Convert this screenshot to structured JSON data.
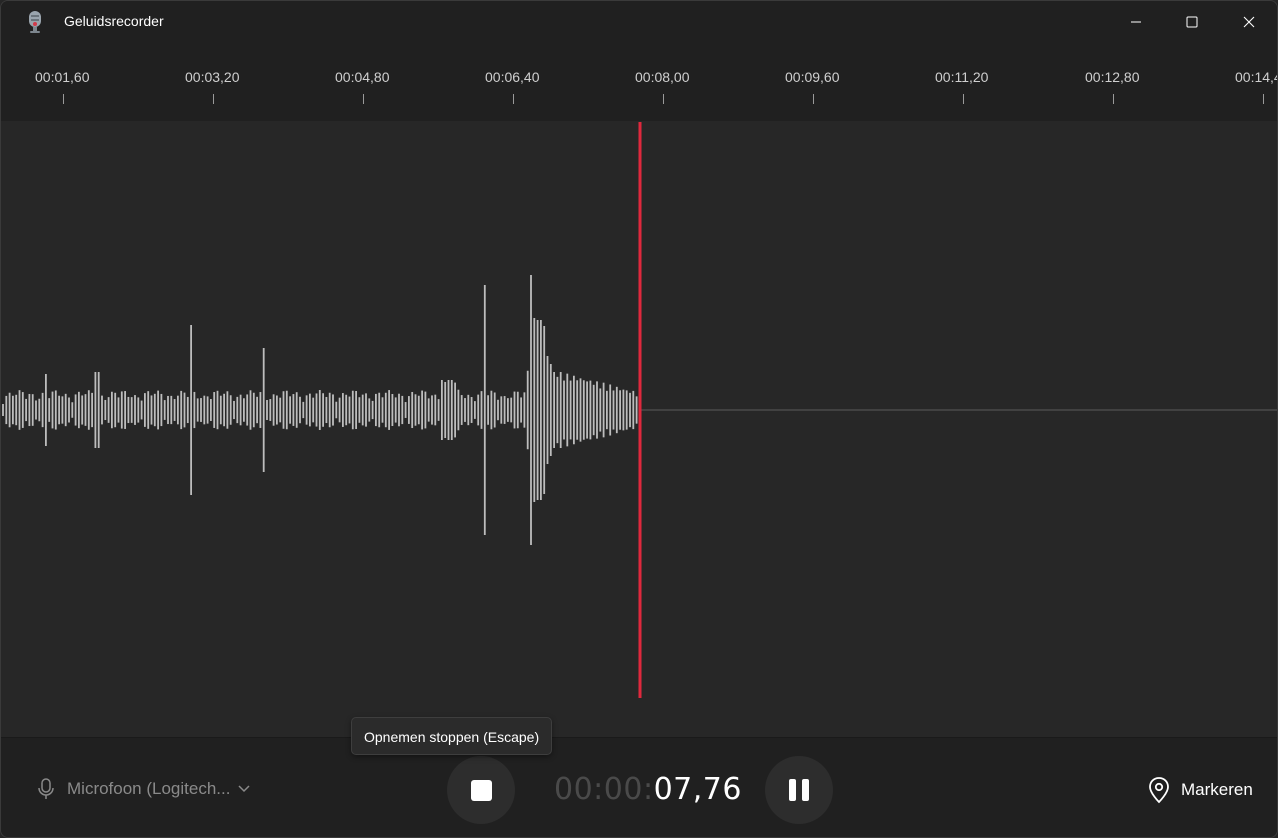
{
  "window": {
    "title": "Geluidsrecorder",
    "buttons": {
      "minimize_icon": "minimize-icon",
      "maximize_icon": "maximize-icon",
      "close_icon": "close-icon"
    }
  },
  "timeline": {
    "ticks": [
      "00:01,60",
      "00:03,20",
      "00:04,80",
      "00:06,40",
      "00:08,00",
      "00:09,60",
      "00:11,20",
      "00:12,80",
      "00:14,4"
    ]
  },
  "recording": {
    "elapsed_dim": "00:00:",
    "elapsed_bright": "07,76",
    "playhead_color": "#e0283d",
    "waveform_color": "#bdbdbd"
  },
  "controls": {
    "microphone_label": "Microfoon (Logitech...",
    "stop_tooltip": "Opnemen stoppen (Escape)",
    "marker_label": "Markeren"
  }
}
